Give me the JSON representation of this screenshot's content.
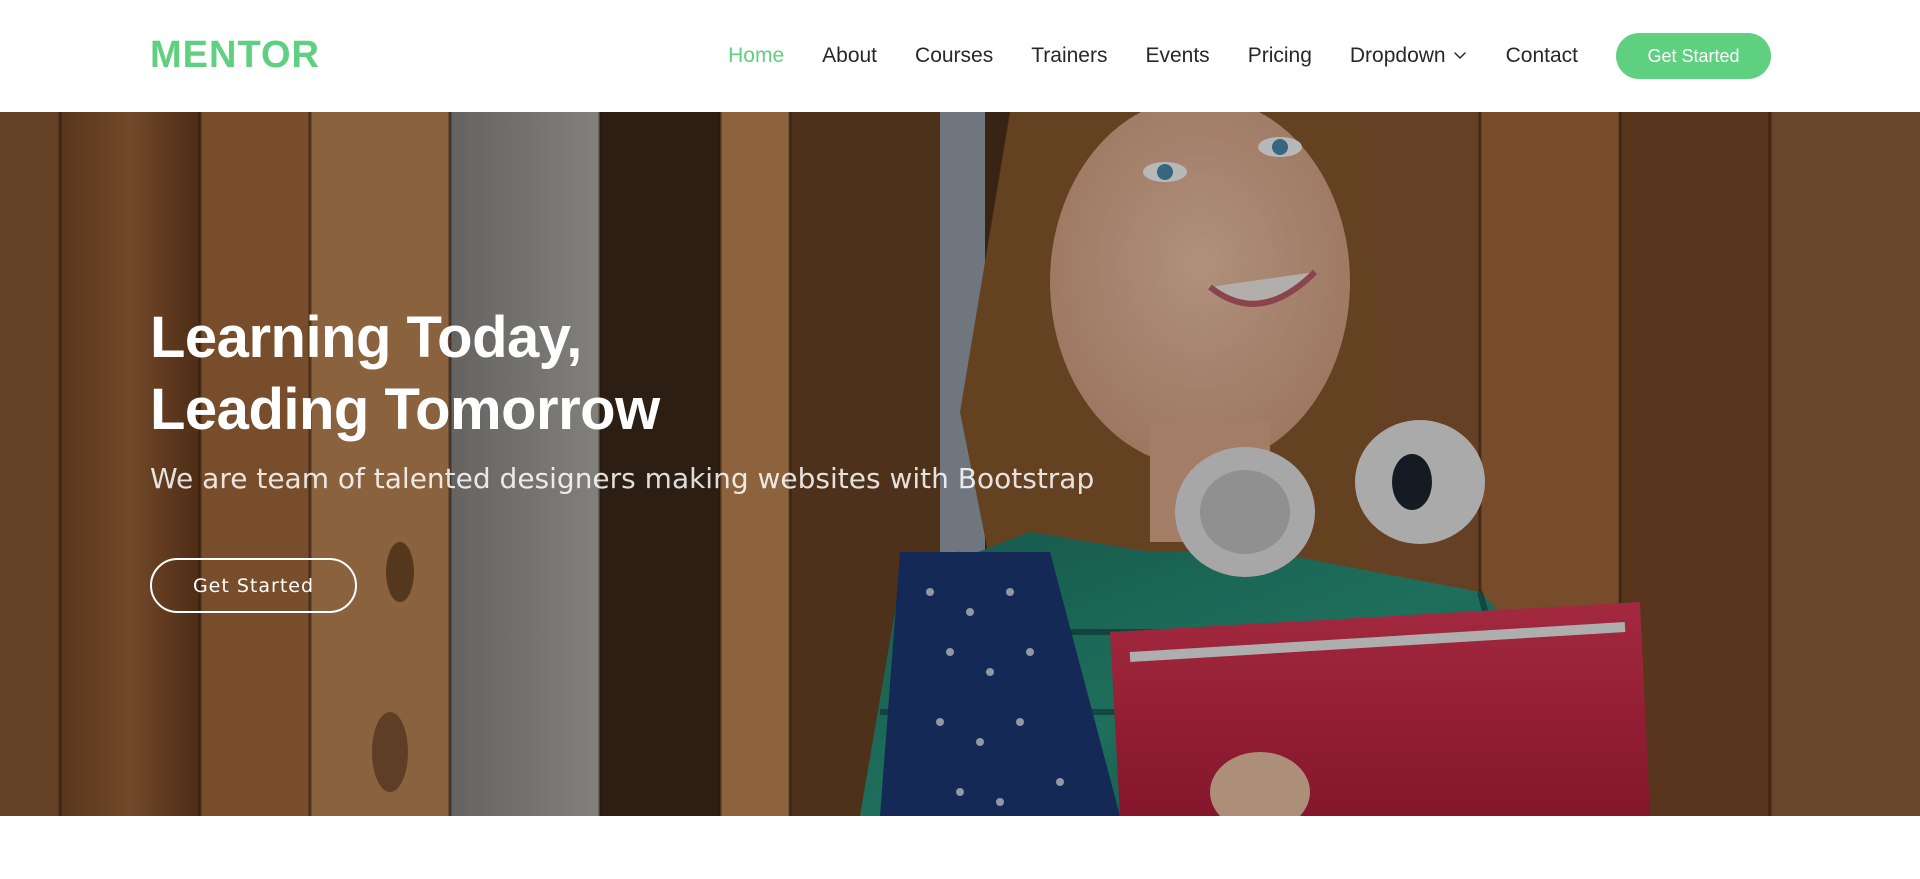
{
  "header": {
    "logo": "MENTOR",
    "nav": [
      {
        "label": "Home",
        "active": true
      },
      {
        "label": "About",
        "active": false
      },
      {
        "label": "Courses",
        "active": false
      },
      {
        "label": "Trainers",
        "active": false
      },
      {
        "label": "Events",
        "active": false
      },
      {
        "label": "Pricing",
        "active": false
      },
      {
        "label": "Dropdown",
        "active": false,
        "icon": "chevron-down-icon"
      },
      {
        "label": "Contact",
        "active": false
      }
    ],
    "cta_label": "Get Started"
  },
  "hero": {
    "title_line1": "Learning Today,",
    "title_line2": "Leading Tomorrow",
    "subtitle": "We are team of talented designers making websites with Bootstrap",
    "cta_label": "Get Started"
  },
  "colors": {
    "accent": "#5fcf80",
    "nav_text": "#272828",
    "white": "#ffffff"
  }
}
